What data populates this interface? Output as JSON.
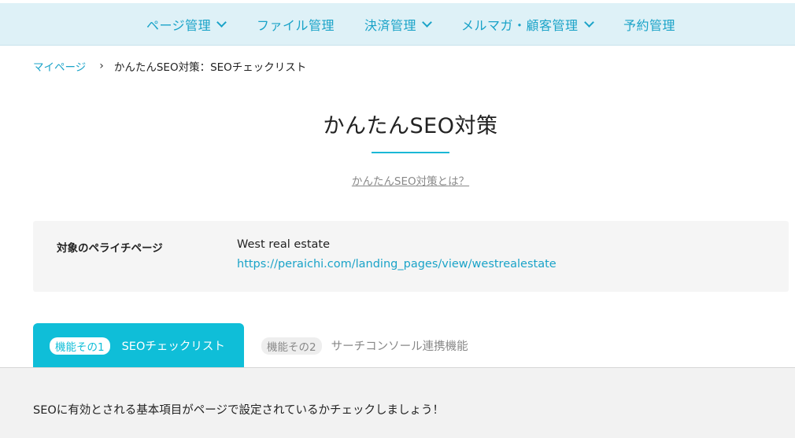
{
  "nav": {
    "items": [
      {
        "label": "ページ管理",
        "has_dropdown": true
      },
      {
        "label": "ファイル管理",
        "has_dropdown": false
      },
      {
        "label": "決済管理",
        "has_dropdown": true
      },
      {
        "label": "メルマガ・顧客管理",
        "has_dropdown": true
      },
      {
        "label": "予約管理",
        "has_dropdown": false
      }
    ]
  },
  "breadcrumb": {
    "home": "マイページ",
    "separator": "›",
    "current": "かんたんSEO対策：SEOチェックリスト"
  },
  "page": {
    "title": "かんたんSEO対策",
    "about_link": "かんたんSEO対策とは？"
  },
  "target": {
    "label": "対象のペライチページ",
    "name": "West real estate",
    "url": "https://peraichi.com/landing_pages/view/westrealestate"
  },
  "tabs": [
    {
      "badge": "機能その1",
      "label": "SEOチェックリスト",
      "active": true
    },
    {
      "badge": "機能その2",
      "label": "サーチコンソール連携機能",
      "active": false
    }
  ],
  "panel": {
    "intro": "SEOに有効とされる基本項目がページで設定されているかチェックしましょう！"
  },
  "colors": {
    "accent": "#0fbed8",
    "link": "#1aa3c8",
    "nav_bg": "#def1f7"
  },
  "icons": [
    "chevron-down-icon"
  ]
}
